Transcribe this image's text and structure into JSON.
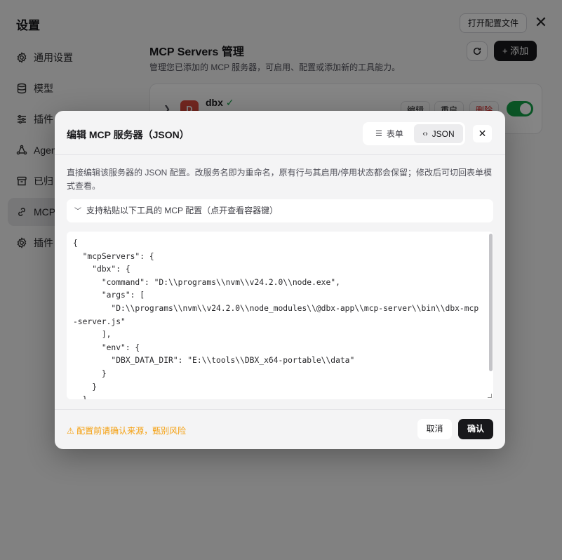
{
  "settings": {
    "title": "设置",
    "open_config_label": "打开配置文件",
    "close_glyph": "✕",
    "nav": [
      {
        "label": "通用设置",
        "icon": "gear-icon"
      },
      {
        "label": "模型",
        "icon": "database-icon"
      },
      {
        "label": "插件",
        "icon": "sliders-icon"
      },
      {
        "label": "Agen",
        "icon": "agent-icon"
      },
      {
        "label": "已归",
        "icon": "archive-icon"
      },
      {
        "label": "MCP",
        "icon": "link-icon"
      },
      {
        "label": "插件",
        "icon": "gear-icon"
      }
    ]
  },
  "mcp": {
    "title": "MCP Servers 管理",
    "subtitle": "管理您已添加的 MCP 服务器，可启用、配置或添加新的工具能力。",
    "add_label": "+ 添加",
    "server": {
      "avatar": "D",
      "name": "dbx",
      "check": "✓",
      "edit_label": "编辑",
      "restart_label": "重启",
      "delete_label": "删除",
      "enabled": true
    }
  },
  "modal": {
    "title": "编辑 MCP 服务器（JSON）",
    "tab_form": "表单",
    "tab_json": "JSON",
    "close_glyph": "✕",
    "description": "直接编辑该服务器的 JSON 配置。改服务名即为重命名，原有行与其启用/停用状态都会保留；修改后可切回表单模式查看。",
    "collapse_label": "支持粘贴以下工具的 MCP 配置（点开查看容器键）",
    "editor_text": "{\n  \"mcpServers\": {\n    \"dbx\": {\n      \"command\": \"D:\\\\programs\\\\nvm\\\\v24.2.0\\\\node.exe\",\n      \"args\": [\n        \"D:\\\\programs\\\\nvm\\\\v24.2.0\\\\node_modules\\\\@dbx-app\\\\mcp-server\\\\bin\\\\dbx-mcp-server.js\"\n      ],\n      \"env\": {\n        \"DBX_DATA_DIR\": \"E:\\\\tools\\\\DBX_x64-portable\\\\data\"\n      }\n    }\n  }\n}",
    "warning": "⚠ 配置前请确认来源，甄别风险",
    "cancel_label": "取消",
    "confirm_label": "确认"
  },
  "colors": {
    "accent": "#18181b",
    "success": "#16a34a",
    "danger": "#dc2626",
    "warning": "#f59e0b"
  }
}
